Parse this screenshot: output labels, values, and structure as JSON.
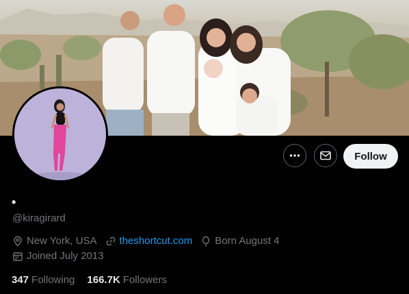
{
  "profile": {
    "name": "•",
    "handle": "@kiragirard",
    "location": "New York, USA",
    "website": "theshortcut.com",
    "birthday": "Born August 4",
    "joined": "Joined July 2013"
  },
  "stats": {
    "following_count": "347",
    "following_label": "Following",
    "followers_count": "166.7K",
    "followers_label": "Followers"
  },
  "actions": {
    "follow_label": "Follow",
    "more_icon": "more-icon",
    "message_icon": "envelope-icon"
  },
  "colors": {
    "background": "#000000",
    "link": "#1d9bf0",
    "secondary_text": "#71767b",
    "follow_button_bg": "#eff3f4"
  }
}
